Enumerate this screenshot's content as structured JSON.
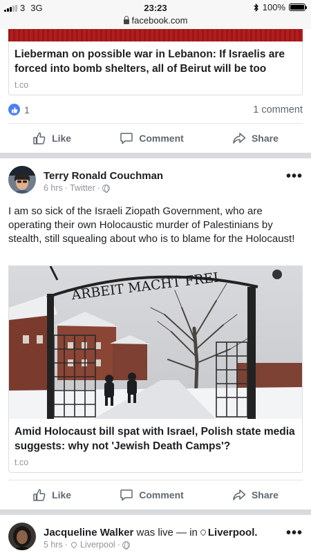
{
  "status_bar": {
    "carrier": "3",
    "network": "3G",
    "time": "23:23",
    "battery": "100%",
    "battery_level": 1.0,
    "signal_bars": 3,
    "signal_bars_total": 5
  },
  "browser": {
    "url": "facebook.com"
  },
  "post1": {
    "link_title": "Lieberman on possible war in Lebanon: If Israelis are forced into bomb shelters, all of Beirut will be too",
    "link_domain": "t.co",
    "like_count": "1",
    "comment_count": "1 comment"
  },
  "actions": {
    "like": "Like",
    "comment": "Comment",
    "share": "Share"
  },
  "post2": {
    "author": "Terry Ronald Couchman",
    "time": "6 hrs",
    "source": "Twitter",
    "text": "I am so sick of the Israeli Ziopath Government, who are operating their own Holocaustic murder of Palestinians by stealth, still squealing about who is to blame for the Holocaust!",
    "image_sign_text": "ARBEIT MACHT FREI",
    "link_title": "Amid Holocaust bill spat with Israel, Polish state media suggests: why not 'Jewish Death Camps'?",
    "link_domain": "t.co"
  },
  "post3": {
    "author": "Jacqueline Walker",
    "action_text": "was live — in",
    "location": "Liverpool.",
    "time": "5 hrs",
    "meta_location": "Liverpool"
  },
  "icons": {
    "like": "thumbs-up-icon",
    "comment": "speech-bubble-icon",
    "share": "share-arrow-icon",
    "privacy": "globe-icon",
    "location": "location-pin-icon",
    "more": "more-dots-icon"
  },
  "colors": {
    "facebook_blue": "#4a7ff6",
    "meta_grey": "#90949c",
    "divider": "#d9dadd"
  }
}
